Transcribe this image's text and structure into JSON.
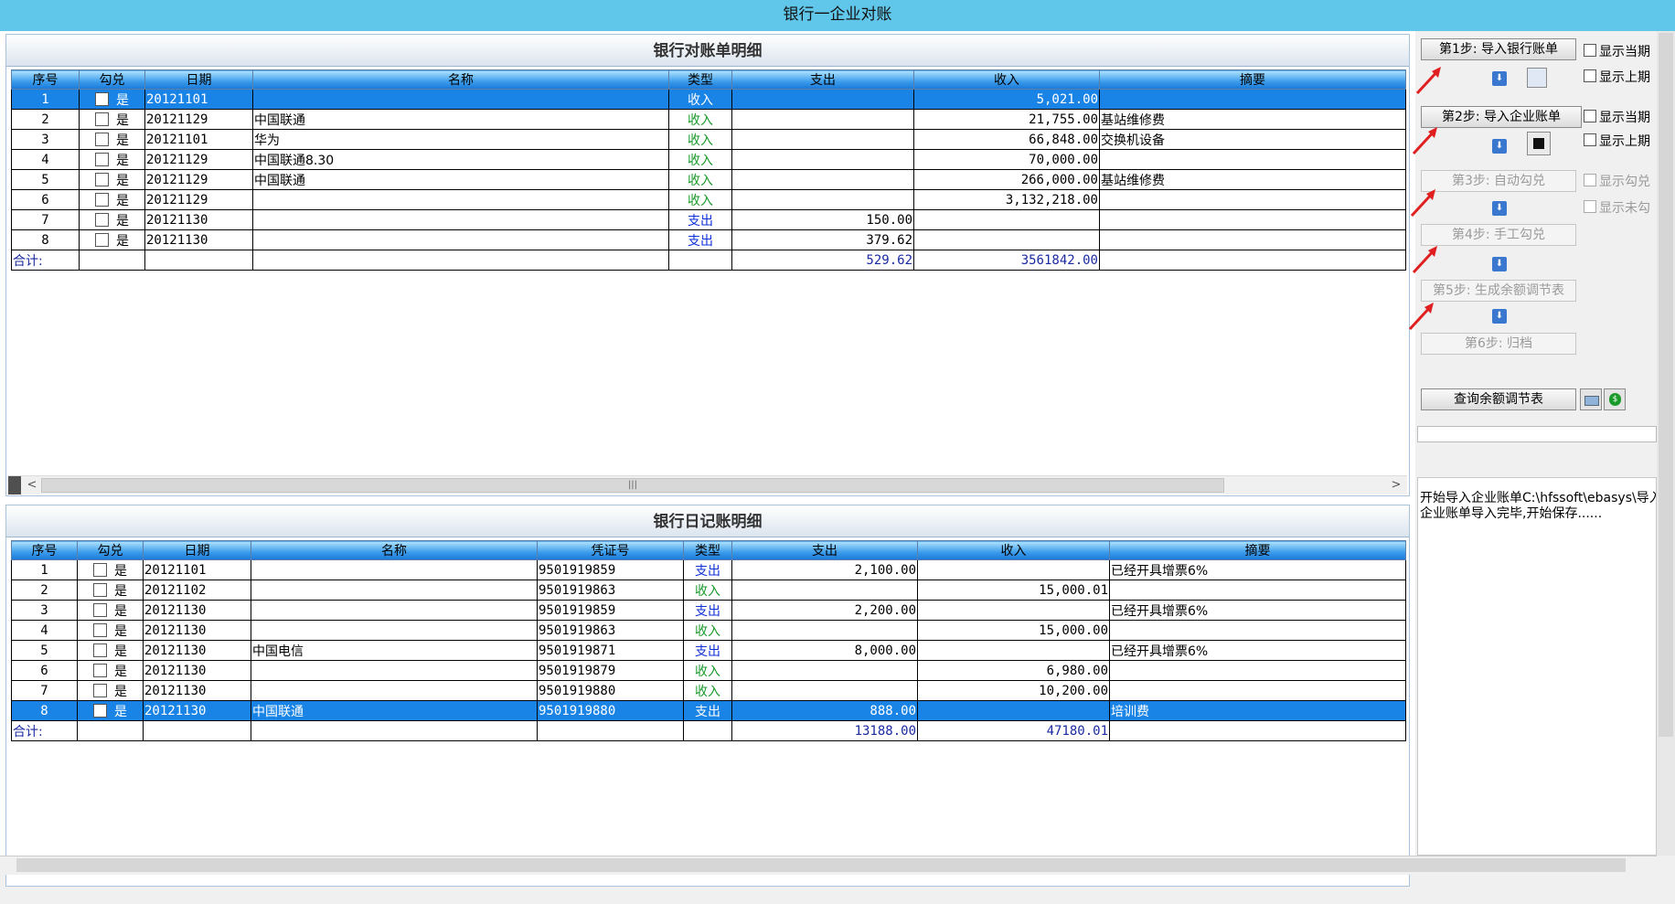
{
  "window": {
    "title": "银行一企业对账"
  },
  "bank_panel": {
    "title": "银行对账单明细",
    "columns": [
      "序号",
      "勾兑",
      "日期",
      "名称",
      "类型",
      "支出",
      "收入",
      "摘要"
    ],
    "rows": [
      {
        "no": "1",
        "check": "是",
        "date": "20121101",
        "name": "",
        "type": "收入",
        "out": "",
        "in": "5,021.00",
        "memo": "",
        "selected": true
      },
      {
        "no": "2",
        "check": "是",
        "date": "20121129",
        "name": "中国联通",
        "type": "收入",
        "out": "",
        "in": "21,755.00",
        "memo": "基站维修费"
      },
      {
        "no": "3",
        "check": "是",
        "date": "20121101",
        "name": "华为",
        "type": "收入",
        "out": "",
        "in": "66,848.00",
        "memo": "交换机设备"
      },
      {
        "no": "4",
        "check": "是",
        "date": "20121129",
        "name": "中国联通8.30",
        "type": "收入",
        "out": "",
        "in": "70,000.00",
        "memo": ""
      },
      {
        "no": "5",
        "check": "是",
        "date": "20121129",
        "name": "中国联通",
        "type": "收入",
        "out": "",
        "in": "266,000.00",
        "memo": "基站维修费"
      },
      {
        "no": "6",
        "check": "是",
        "date": "20121129",
        "name": "",
        "type": "收入",
        "out": "",
        "in": "3,132,218.00",
        "memo": ""
      },
      {
        "no": "7",
        "check": "是",
        "date": "20121130",
        "name": "",
        "type": "支出",
        "out": "150.00",
        "in": "",
        "memo": ""
      },
      {
        "no": "8",
        "check": "是",
        "date": "20121130",
        "name": "",
        "type": "支出",
        "out": "379.62",
        "in": "",
        "memo": ""
      }
    ],
    "total": {
      "label": "合计:",
      "out": "529.62",
      "in": "3561842.00"
    }
  },
  "journal_panel": {
    "title": "银行日记账明细",
    "columns": [
      "序号",
      "勾兑",
      "日期",
      "名称",
      "凭证号",
      "类型",
      "支出",
      "收入",
      "摘要"
    ],
    "rows": [
      {
        "no": "1",
        "check": "是",
        "date": "20121101",
        "name": "",
        "voucher": "9501919859",
        "type": "支出",
        "out": "2,100.00",
        "in": "",
        "memo": "已经开具增票6%"
      },
      {
        "no": "2",
        "check": "是",
        "date": "20121102",
        "name": "",
        "voucher": "9501919863",
        "type": "收入",
        "out": "",
        "in": "15,000.01",
        "memo": ""
      },
      {
        "no": "3",
        "check": "是",
        "date": "20121130",
        "name": "",
        "voucher": "9501919859",
        "type": "支出",
        "out": "2,200.00",
        "in": "",
        "memo": "已经开具增票6%"
      },
      {
        "no": "4",
        "check": "是",
        "date": "20121130",
        "name": "",
        "voucher": "9501919863",
        "type": "收入",
        "out": "",
        "in": "15,000.00",
        "memo": ""
      },
      {
        "no": "5",
        "check": "是",
        "date": "20121130",
        "name": "中国电信",
        "voucher": "9501919871",
        "type": "支出",
        "out": "8,000.00",
        "in": "",
        "memo": "已经开具增票6%"
      },
      {
        "no": "6",
        "check": "是",
        "date": "20121130",
        "name": "",
        "voucher": "9501919879",
        "type": "收入",
        "out": "",
        "in": "6,980.00",
        "memo": ""
      },
      {
        "no": "7",
        "check": "是",
        "date": "20121130",
        "name": "",
        "voucher": "9501919880",
        "type": "收入",
        "out": "",
        "in": "10,200.00",
        "memo": ""
      },
      {
        "no": "8",
        "check": "是",
        "date": "20121130",
        "name": "中国联通",
        "voucher": "9501919880",
        "type": "支出",
        "out": "888.00",
        "in": "",
        "memo": "培训费",
        "selected": true
      }
    ],
    "total": {
      "label": "合计:",
      "out": "13188.00",
      "in": "47180.01"
    }
  },
  "sidebar": {
    "step1": "第1步: 导入银行账单",
    "step2": "第2步: 导入企业账单",
    "step3": "第3步: 自动勾兑",
    "step4": "第4步: 手工勾兑",
    "step5": "第5步: 生成余额调节表",
    "step6": "第6步: 归档",
    "query": "查询余额调节表",
    "cb_bank_current": "显示当期",
    "cb_bank_prev": "显示上期",
    "cb_ent_current": "显示当期",
    "cb_ent_prev": "显示上期",
    "cb_checked": "显示勾兑",
    "cb_unchecked": "显示未勾"
  },
  "log": {
    "line1": "开始导入企业账单C:\\hfssoft\\ebasys\\导入",
    "line2": "企业账单导入完毕,开始保存......"
  },
  "colors": {
    "titlebar": "#60c6ea",
    "selected_row": "#1a84e6",
    "income": "#1a9a2a",
    "expense": "#1030d8"
  }
}
